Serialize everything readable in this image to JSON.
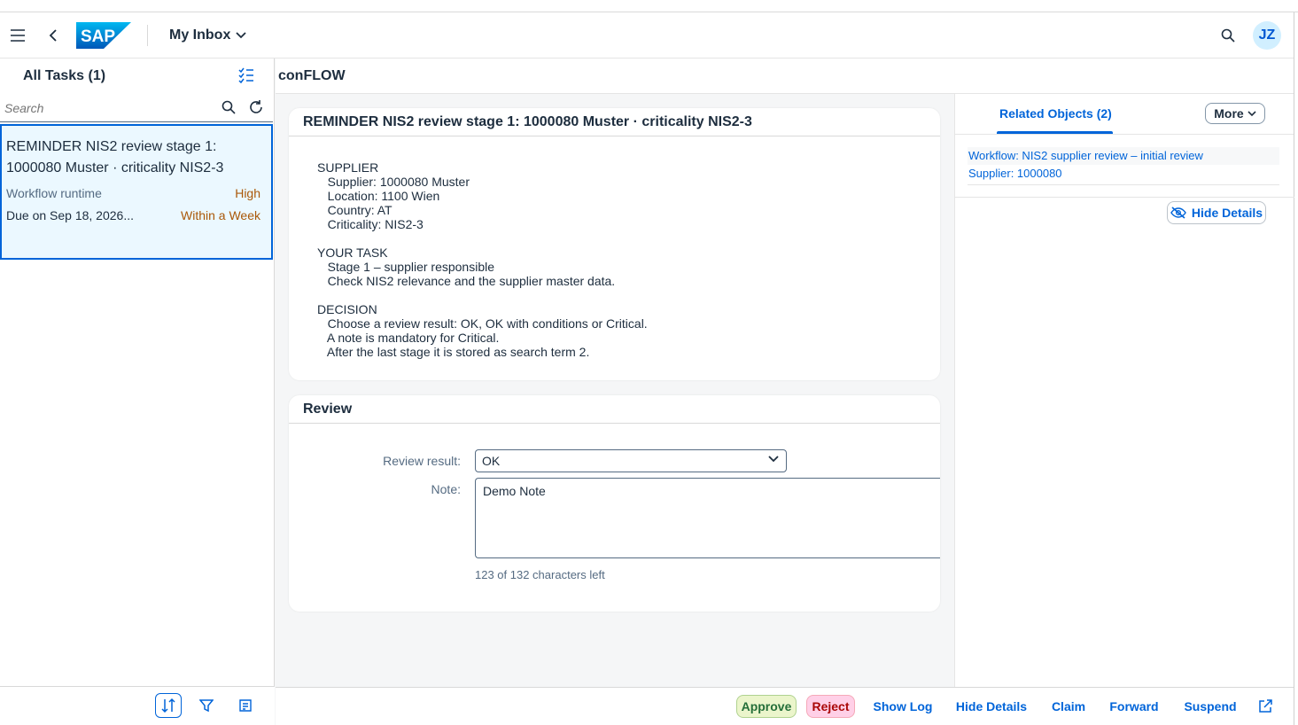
{
  "shell": {
    "logo_text": "SAP",
    "app_title": "My Inbox",
    "avatar_initials": "JZ"
  },
  "master": {
    "title": "All Tasks (1)",
    "search_placeholder": "Search",
    "task": {
      "title": "REMINDER NIS2 review stage 1: 1000080 Muster · criticality NIS2-3",
      "type": "Workflow runtime",
      "priority": "High",
      "due": "Due on Sep 18, 2026...",
      "due_status": "Within a Week"
    }
  },
  "detail": {
    "header": "conFLOW",
    "task_title": "REMINDER NIS2 review stage 1: 1000080 Muster · criticality NIS2-3",
    "description": "SUPPLIER\n   Supplier: 1000080 Muster\n   Location: 1100 Wien\n   Country: AT\n   Criticality: NIS2-3\n\nYOUR TASK\n   Stage 1 – supplier responsible\n   Check NIS2 relevance and the supplier master data.\n\nDECISION\n   Choose a review result: OK, OK with conditions or Critical.\n   A note is mandatory for Critical.\n   After the last stage it is stored as search term 2.",
    "review": {
      "title": "Review",
      "result_label": "Review result:",
      "result_value": "OK",
      "note_label": "Note:",
      "note_value": "Demo Note",
      "char_count": "123 of 132 characters left"
    }
  },
  "side": {
    "tab": "Related Objects (2)",
    "more": "More",
    "links": [
      "Workflow: NIS2 supplier review – initial review",
      "Supplier: 1000080"
    ],
    "hide_details": "Hide Details"
  },
  "footer": {
    "approve": "Approve",
    "reject": "Reject",
    "show_log": "Show Log",
    "hide_details": "Hide Details",
    "claim": "Claim",
    "forward": "Forward",
    "suspend": "Suspend"
  },
  "colors": {
    "brand": "#0064d9",
    "approve_bg": "#ebf5cb",
    "reject_bg": "#ffd0e7",
    "warning": "#aa5808"
  }
}
